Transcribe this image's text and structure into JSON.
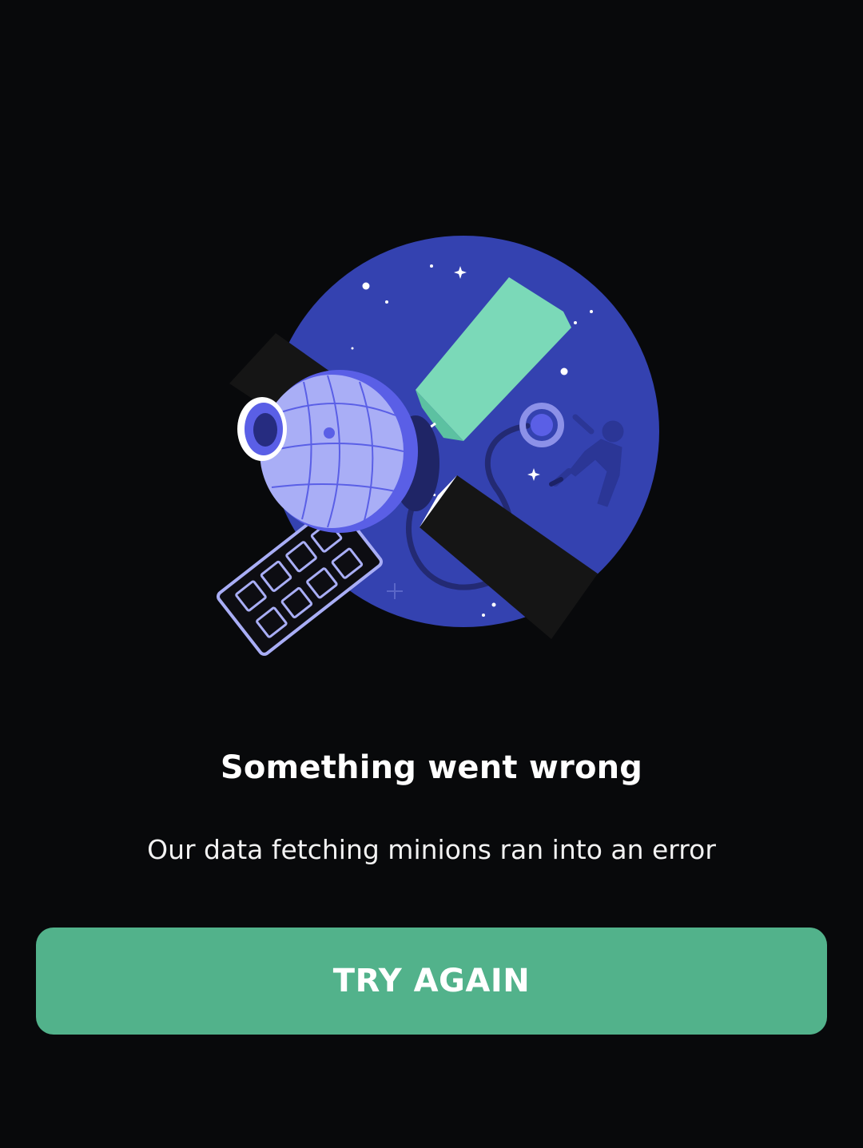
{
  "error": {
    "title": "Something went wrong",
    "message": "Our data fetching minions ran into an error"
  },
  "actions": {
    "retry_label": "TRY AGAIN"
  },
  "illustration": {
    "icon": "satellite-in-space-illustration",
    "colors": {
      "background": "#08090b",
      "planet": "#3442b0",
      "solar_panel_accent": "#7bd9b8",
      "satellite_body": "#a9aef6",
      "satellite_ring": "#5a5fe6",
      "button": "#52b28b"
    }
  }
}
